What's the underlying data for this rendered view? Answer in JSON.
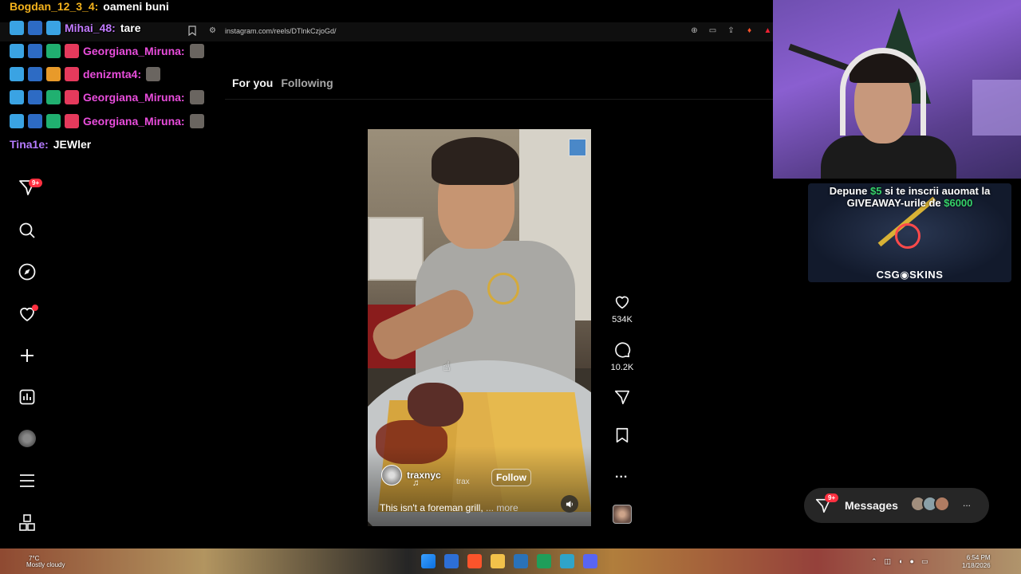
{
  "browser": {
    "url": "instagram.com/reels/DTlnkCzjoGd/"
  },
  "chat": {
    "messages": [
      {
        "user": "Bogdan_12_3_4:",
        "text": "oameni buni",
        "color": "#f3b21c"
      },
      {
        "user": "Mihai_48:",
        "text": "tare",
        "color": "#c27bff"
      },
      {
        "user": "Georgiana_Miruna:",
        "text": "",
        "color": "#e94ddc"
      },
      {
        "user": "denizmta4:",
        "text": "",
        "color": "#e94ddc"
      },
      {
        "user": "Georgiana_Miruna:",
        "text": "",
        "color": "#e94ddc"
      },
      {
        "user": "Georgiana_Miruna:",
        "text": "",
        "color": "#e94ddc"
      },
      {
        "user": "Tina1e:",
        "text": "JEWler",
        "color": "#b57bff"
      }
    ]
  },
  "instagram": {
    "tabs": {
      "for_you": "For you",
      "following": "Following"
    },
    "nav": {
      "notifications_badge": "9+",
      "icons": [
        "reels-icon",
        "messenger-icon",
        "search-icon",
        "explore-icon",
        "heart-icon",
        "create-icon",
        "dashboard-icon",
        "profile-avatar",
        "menu-icon",
        "apps-icon"
      ]
    },
    "reel": {
      "author": "traxnyc",
      "audio_label": "trax",
      "follow_label": "Follow",
      "caption": "This isn't a foreman grill,",
      "caption_more": "... more",
      "likes": "534K",
      "comments": "10.2K",
      "more": "..."
    },
    "messages": {
      "label": "Messages",
      "badge": "9+",
      "more": "..."
    }
  },
  "ad": {
    "line1_pre": "Depune ",
    "line1_highlight": "$5",
    "line1_post": " si te inscrii auomat la",
    "line2_pre": "GIVEAWAY-urile de ",
    "line2_highlight": "$6000",
    "brand": "CSG◉SKINS"
  },
  "taskbar": {
    "weather_temp": "7°C",
    "weather_text": "Mostly cloudy",
    "time": "6:54 PM",
    "date": "1/18/2026"
  },
  "colors": {
    "accent_red": "#ff3040",
    "ad_green": "#35d26a",
    "background": "#000000"
  }
}
